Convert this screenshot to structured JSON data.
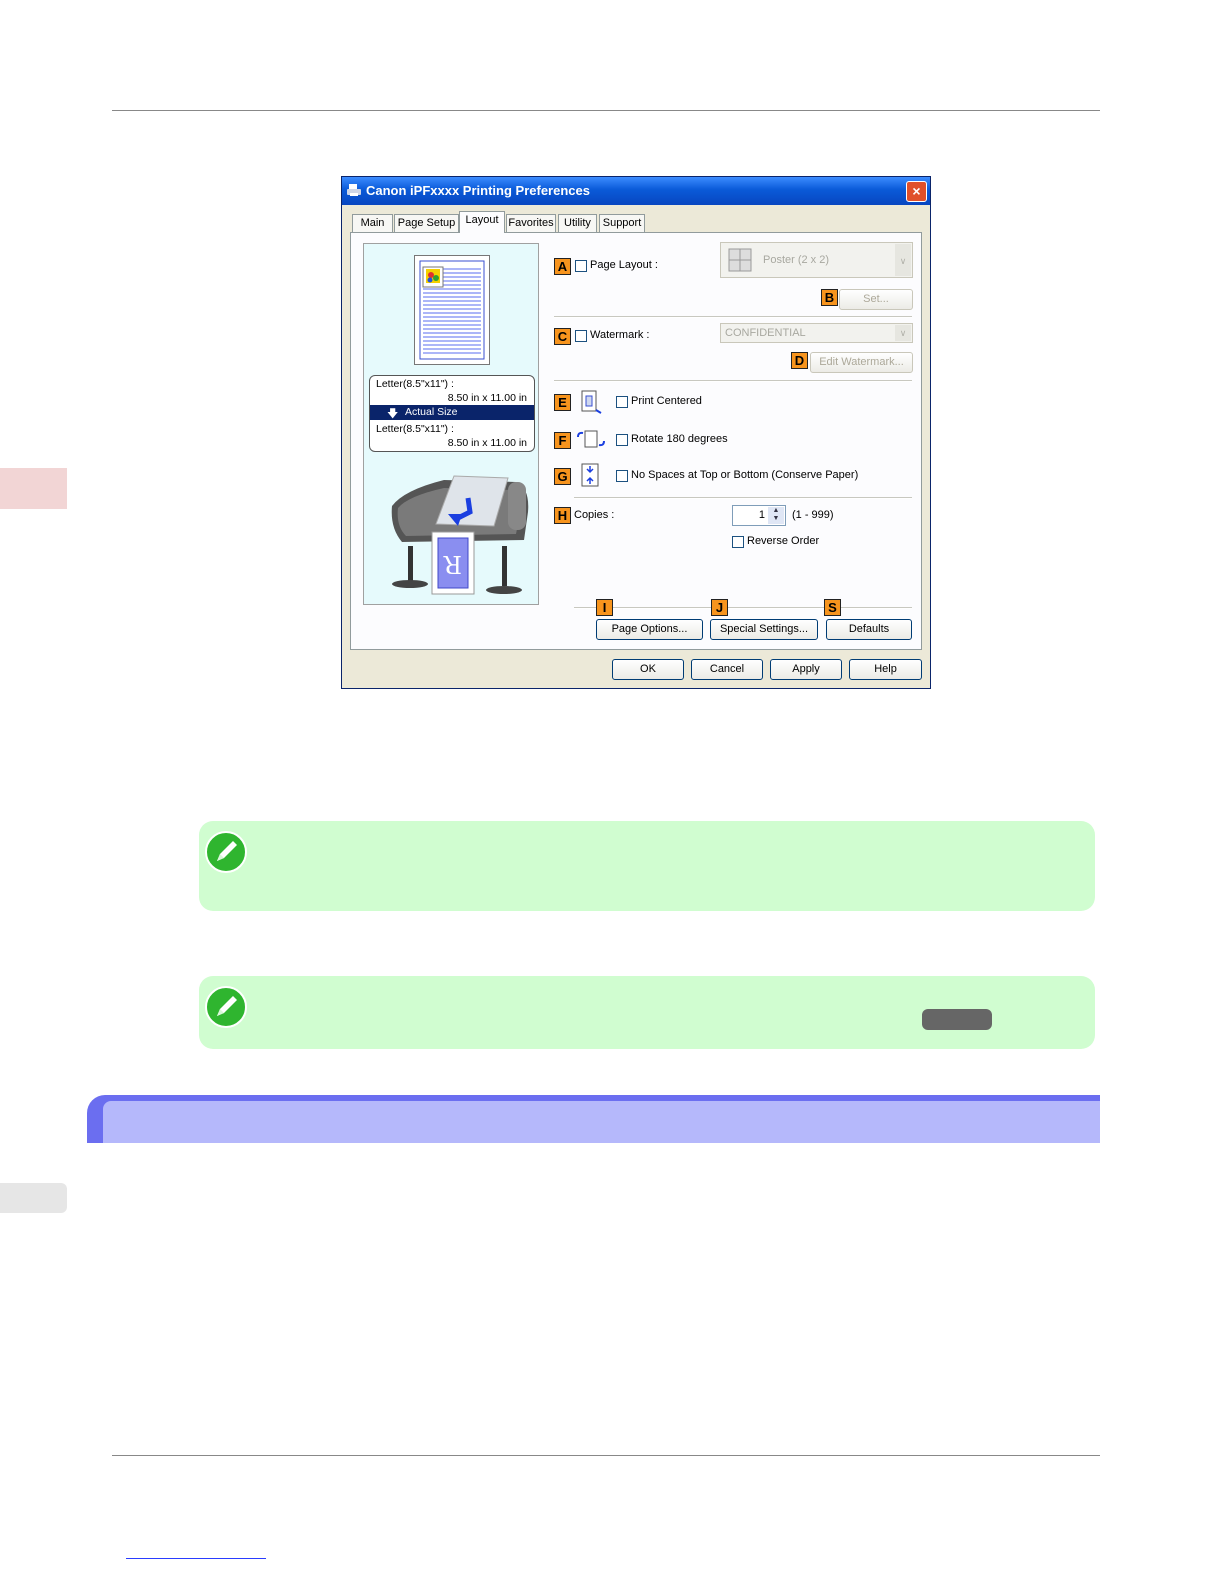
{
  "dialog": {
    "title": "Canon iPFxxxx Printing Preferences",
    "close_label": "×",
    "tabs": [
      {
        "label": "Main"
      },
      {
        "label": "Page Setup"
      },
      {
        "label": "Layout",
        "active": true
      },
      {
        "label": "Favorites"
      },
      {
        "label": "Utility"
      },
      {
        "label": "Support"
      }
    ],
    "preview": {
      "paper_line1": "Letter(8.5\"x11\") :",
      "paper_line2": "8.50 in x 11.00 in",
      "scaling": "Actual Size",
      "output_line1": "Letter(8.5\"x11\") :",
      "output_line2": "8.50 in x 11.00 in"
    },
    "page_layout": {
      "badge": "A",
      "label": "Page Layout :",
      "checked": false,
      "value": "Poster (2 x 2)",
      "set_badge": "B",
      "set_button": "Set..."
    },
    "watermark": {
      "badge": "C",
      "label": "Watermark :",
      "checked": false,
      "value": "CONFIDENTIAL",
      "edit_badge": "D",
      "edit_button": "Edit Watermark..."
    },
    "print_centered": {
      "badge": "E",
      "label": "Print Centered",
      "checked": false
    },
    "rotate": {
      "badge": "F",
      "label": "Rotate 180 degrees",
      "checked": false
    },
    "no_spaces": {
      "badge": "G",
      "label": "No Spaces at Top or Bottom (Conserve Paper)",
      "checked": false
    },
    "copies": {
      "badge": "H",
      "label": "Copies :",
      "value": "1",
      "range": "(1 - 999)",
      "reverse_label": "Reverse Order",
      "reverse_checked": false
    },
    "bottom_buttons": [
      {
        "badge": "I",
        "label": "Page Options..."
      },
      {
        "badge": "J",
        "label": "Special Settings..."
      },
      {
        "badge": "S",
        "label": "Defaults"
      }
    ],
    "footer_buttons": {
      "ok": "OK",
      "cancel": "Cancel",
      "apply": "Apply",
      "help": "Help"
    }
  },
  "colors": {
    "badge": "#f7941d",
    "note_bg": "#d0fdd0",
    "section_header": "#6b6ef0",
    "titlebar": "#0a5ad8"
  },
  "icons": [
    "printer-icon",
    "close-icon",
    "pencil-note-icon",
    "poster-layout-icon",
    "print-centered-icon",
    "rotate-icon",
    "conserve-paper-icon",
    "spinner-arrows-icon",
    "chevron-down-icon",
    "arrow-down-icon"
  ]
}
